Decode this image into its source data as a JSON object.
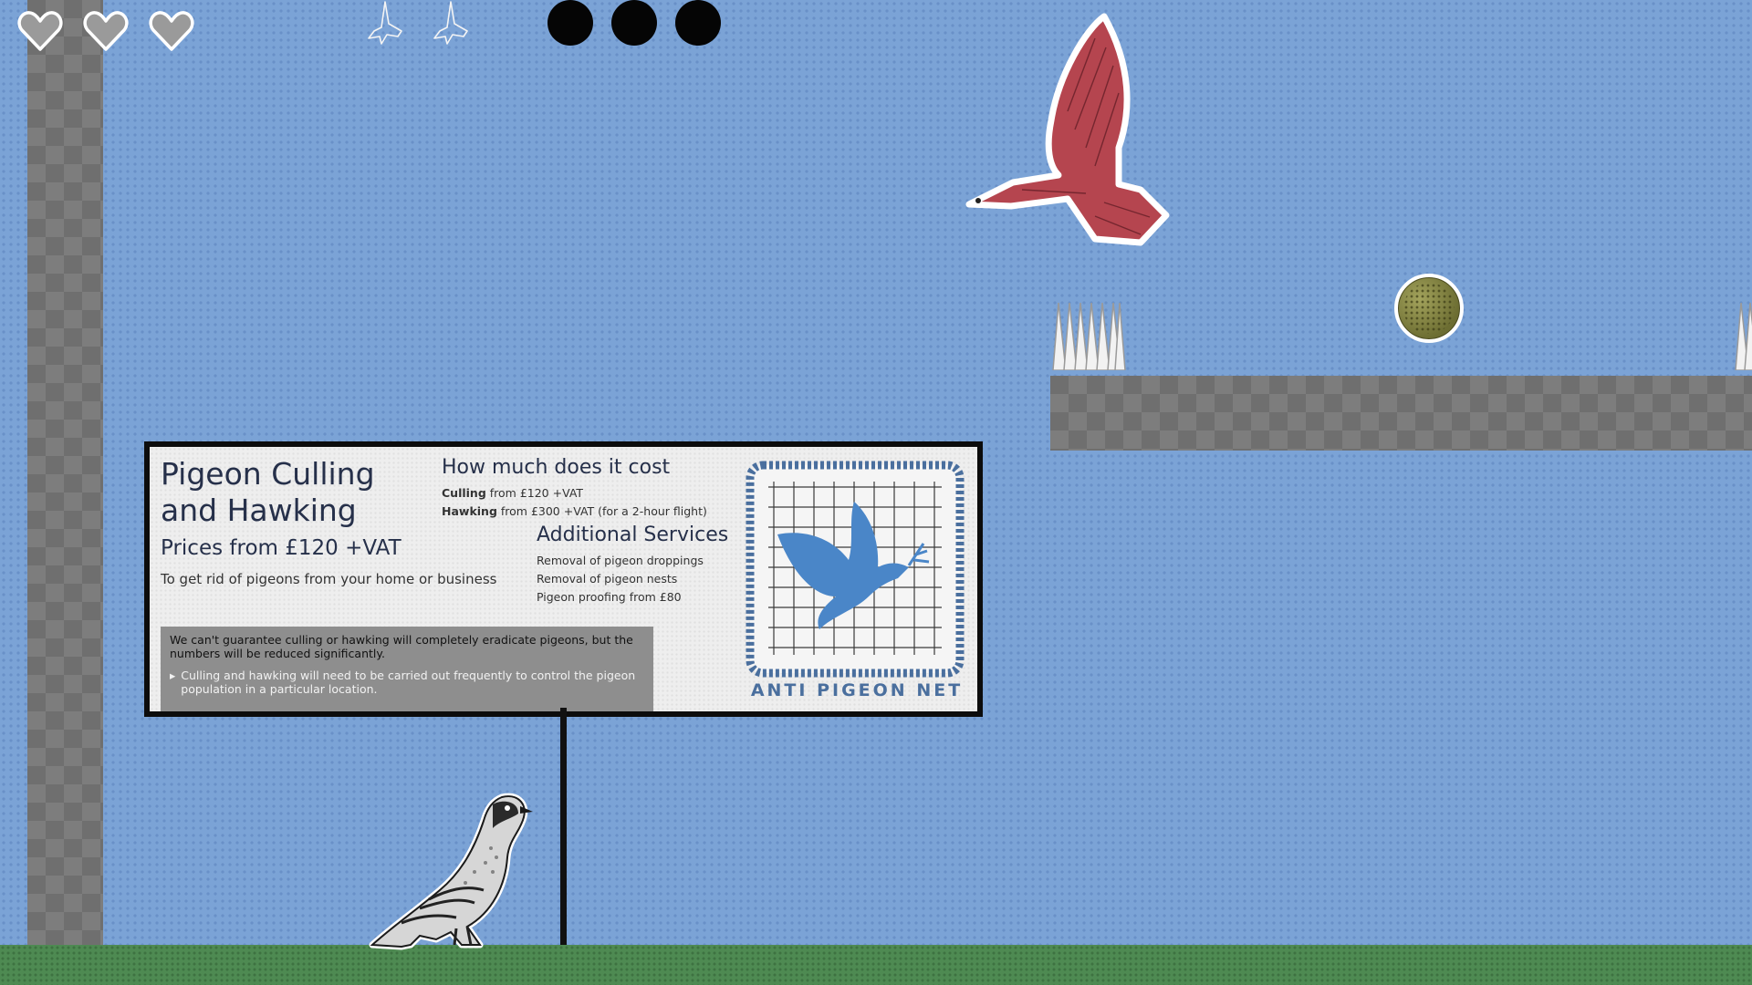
{
  "hud": {
    "lives_total": 3,
    "lives_remaining": 3,
    "bird_icons": 2,
    "dots": 3
  },
  "billboard": {
    "title": "Pigeon Culling and Hawking",
    "price": "Prices from £120 +VAT",
    "tagline": "To get rid of pigeons from your home or business",
    "cost_heading": "How much does it cost",
    "cost_items": [
      {
        "label": "Culling",
        "text": "from £120 +VAT"
      },
      {
        "label": "Hawking",
        "text": "from £300 +VAT (for a 2-hour flight)"
      }
    ],
    "additional_heading": "Additional Services",
    "additional_items": [
      {
        "label": "Removal of pigeon droppings",
        "text": ""
      },
      {
        "label": "Removal of pigeon nests",
        "text": ""
      },
      {
        "label": "Pigeon proofing",
        "text": "from £80"
      }
    ],
    "disclaimer": "We can't guarantee culling or hawking will completely eradicate pigeons, but the numbers will be reduced significantly.",
    "disclaimer_bullet": "Culling and hawking will need to be carried out frequently to control the pigeon population in a particular location.",
    "logo_text": "ANTI PIGEON NET"
  },
  "colors": {
    "sky": "#7ba3d6",
    "ground": "#4e8a52",
    "falcon": "#b5454f",
    "logo_blue": "#4a86c8"
  },
  "icons": [
    "heart-icon",
    "bird-outline-icon",
    "falcon-sprite",
    "pigeon-sprite",
    "spikes-icon",
    "seed-ball",
    "dove-icon"
  ]
}
